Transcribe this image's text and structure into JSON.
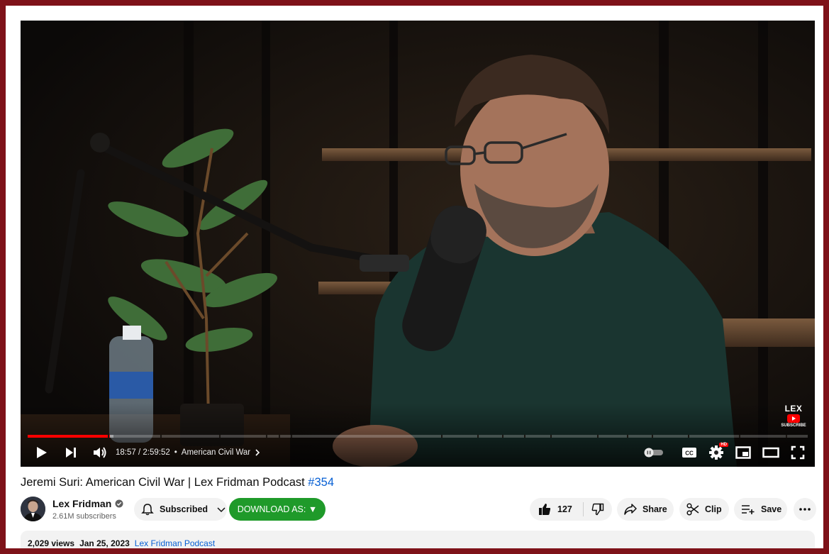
{
  "player": {
    "current_time": "18:57",
    "time_separator": "/",
    "duration": "2:59:52",
    "progress_fraction": 0.105,
    "buffered_fraction": 0.11,
    "chapter_bullet": "•",
    "chapter": "American Civil War",
    "hd_badge": "HD",
    "cc_label": "CC",
    "watermark": {
      "name": "LEX",
      "subscribe": "SUBSCRIBE"
    },
    "icons": [
      "play-icon",
      "next-icon",
      "volume-icon",
      "autoplay-toggle",
      "subtitles-icon",
      "settings-icon",
      "miniplayer-icon",
      "theater-icon",
      "fullscreen-icon"
    ],
    "colors": {
      "progress": "#ff0000"
    }
  },
  "video": {
    "title": "Jeremi Suri: American Civil War | Lex Fridman Podcast ",
    "title_tag": "#354"
  },
  "channel": {
    "name": "Lex Fridman",
    "subscribers": "2.61M subscribers",
    "subscribed_label": "Subscribed",
    "download_label": "DOWNLOAD AS: ▼"
  },
  "actions": {
    "like_count": "127",
    "share_label": "Share",
    "clip_label": "Clip",
    "save_label": "Save"
  },
  "description": {
    "views": "2,029 views",
    "date": "Jan 25, 2023",
    "link": "Lex Fridman Podcast"
  },
  "colors": {
    "accent_link": "#065fd4",
    "download_button": "#1f9a2a",
    "frame": "#7e1219"
  }
}
